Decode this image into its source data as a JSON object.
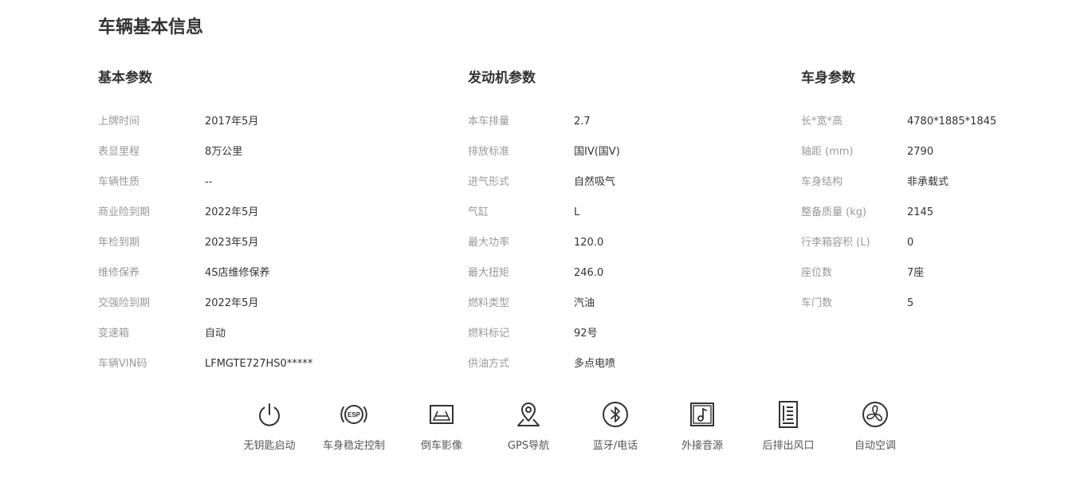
{
  "page_title": "车辆基本信息",
  "sections": [
    {
      "title": "基本参数",
      "rows": [
        {
          "label": "上牌时间",
          "value": "2017年5月"
        },
        {
          "label": "表显里程",
          "value": "8万公里"
        },
        {
          "label": "车辆性质",
          "value": "--"
        },
        {
          "label": "商业险到期",
          "value": "2022年5月"
        },
        {
          "label": "年检到期",
          "value": "2023年5月"
        },
        {
          "label": "维修保养",
          "value": "4S店维修保养"
        },
        {
          "label": "交强险到期",
          "value": "2022年5月"
        },
        {
          "label": "变速箱",
          "value": "自动"
        },
        {
          "label": "车辆VIN码",
          "value": "LFMGTE727HS0*****"
        }
      ]
    },
    {
      "title": "发动机参数",
      "rows": [
        {
          "label": "本车排量",
          "value": "2.7"
        },
        {
          "label": "排放标准",
          "value": "国IV(国V)"
        },
        {
          "label": "进气形式",
          "value": "自然吸气"
        },
        {
          "label": "气缸",
          "value": "L"
        },
        {
          "label": "最大功率",
          "value": "120.0"
        },
        {
          "label": "最大扭矩",
          "value": "246.0"
        },
        {
          "label": "燃料类型",
          "value": "汽油"
        },
        {
          "label": "燃料标记",
          "value": "92号"
        },
        {
          "label": "供油方式",
          "value": "多点电喷"
        }
      ]
    },
    {
      "title": "车身参数",
      "rows": [
        {
          "label": "长*宽*高",
          "value": "4780*1885*1845"
        },
        {
          "label": "轴距 (mm)",
          "value": "2790"
        },
        {
          "label": "车身结构",
          "value": "非承载式"
        },
        {
          "label": "整备质量 (kg)",
          "value": "2145"
        },
        {
          "label": "行李箱容积 (L)",
          "value": "0"
        },
        {
          "label": "座位数",
          "value": "7座"
        },
        {
          "label": "车门数",
          "value": "5"
        }
      ]
    }
  ],
  "features": [
    {
      "label": "无钥匙启动",
      "icon": "power-icon"
    },
    {
      "label": "车身稳定控制",
      "icon": "esp-icon"
    },
    {
      "label": "倒车影像",
      "icon": "reverse-camera-icon"
    },
    {
      "label": "GPS导航",
      "icon": "map-pin-icon"
    },
    {
      "label": "蓝牙/电话",
      "icon": "bluetooth-icon"
    },
    {
      "label": "外接音源",
      "icon": "music-icon"
    },
    {
      "label": "后排出风口",
      "icon": "air-vent-icon"
    },
    {
      "label": "自动空调",
      "icon": "fan-icon"
    }
  ],
  "colors": {
    "label": "#999999",
    "value": "#333333",
    "heading": "#333333",
    "icon": "#333333"
  }
}
